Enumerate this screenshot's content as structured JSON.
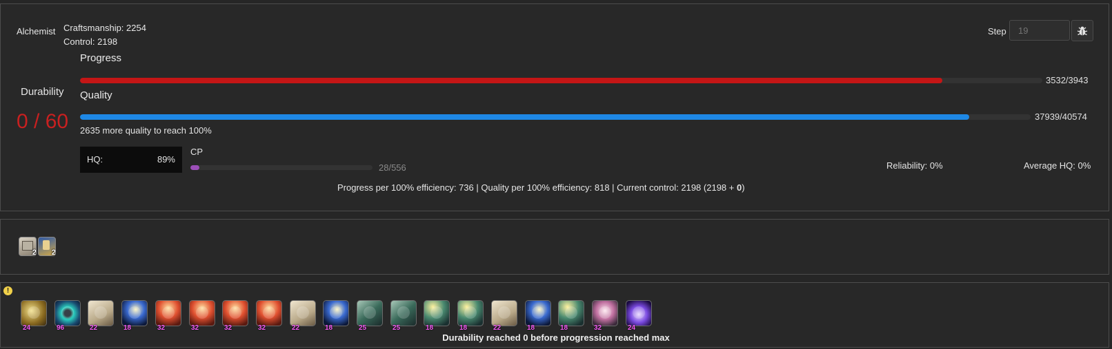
{
  "crafter": {
    "job": "Alchemist",
    "craftsmanship": "Craftsmanship: 2254",
    "control": "Control: 2198"
  },
  "step": {
    "label": "Step",
    "placeholder": "19",
    "debug_icon": "bug-icon"
  },
  "progress": {
    "label": "Progress",
    "value_text": "3532/3943",
    "fraction": 0.8958,
    "color": "#c41616"
  },
  "quality": {
    "label": "Quality",
    "value_text": "37939/40574",
    "fraction": 0.9351,
    "color": "#1e88e5",
    "hint": "2635 more quality to reach 100%"
  },
  "durability": {
    "label": "Durability",
    "value": "0 / 60",
    "color": "#c82020"
  },
  "hq": {
    "label": "HQ:",
    "value": "89%"
  },
  "cp": {
    "label": "CP",
    "value_text": "28/556",
    "fraction": 0.05,
    "color": "#9c4fb8"
  },
  "stats": {
    "reliability": "Reliability: 0%",
    "average_hq": "Average HQ: 0%"
  },
  "footer": {
    "prefix": "Progress per 100% efficiency: 736 | Quality per 100% efficiency: 818 | Current control: 2198 (2198 + ",
    "bonus": "0",
    "suffix": ")"
  },
  "buffs": [
    {
      "icon": "inner-quiet-icon",
      "stacks": "2"
    },
    {
      "icon": "veneration-icon",
      "stacks": "2"
    }
  ],
  "warning_icon": "warning-icon",
  "actions": [
    {
      "icon": "muscle-memory-icon",
      "cost": "24"
    },
    {
      "icon": "manipulation-icon",
      "cost": "96"
    },
    {
      "icon": "waste-not-icon",
      "cost": "22"
    },
    {
      "icon": "innovation-icon",
      "cost": "18"
    },
    {
      "icon": "preparatory-touch-icon",
      "cost": "32"
    },
    {
      "icon": "preparatory-touch-icon",
      "cost": "32"
    },
    {
      "icon": "preparatory-touch-icon",
      "cost": "32"
    },
    {
      "icon": "preparatory-touch-icon",
      "cost": "32"
    },
    {
      "icon": "waste-not-icon",
      "cost": "22"
    },
    {
      "icon": "innovation-icon",
      "cost": "18"
    },
    {
      "icon": "prudent-touch-icon",
      "cost": "25"
    },
    {
      "icon": "prudent-touch-icon",
      "cost": "25"
    },
    {
      "icon": "advanced-touch-icon",
      "cost": "18"
    },
    {
      "icon": "advanced-touch-icon",
      "cost": "18"
    },
    {
      "icon": "waste-not-icon",
      "cost": "22"
    },
    {
      "icon": "innovation-icon",
      "cost": "18"
    },
    {
      "icon": "advanced-touch-icon",
      "cost": "18"
    },
    {
      "icon": "great-strides-icon",
      "cost": "32"
    },
    {
      "icon": "byregots-blessing-icon",
      "cost": "24"
    }
  ],
  "status_message": "Durability reached 0 before progression reached max"
}
